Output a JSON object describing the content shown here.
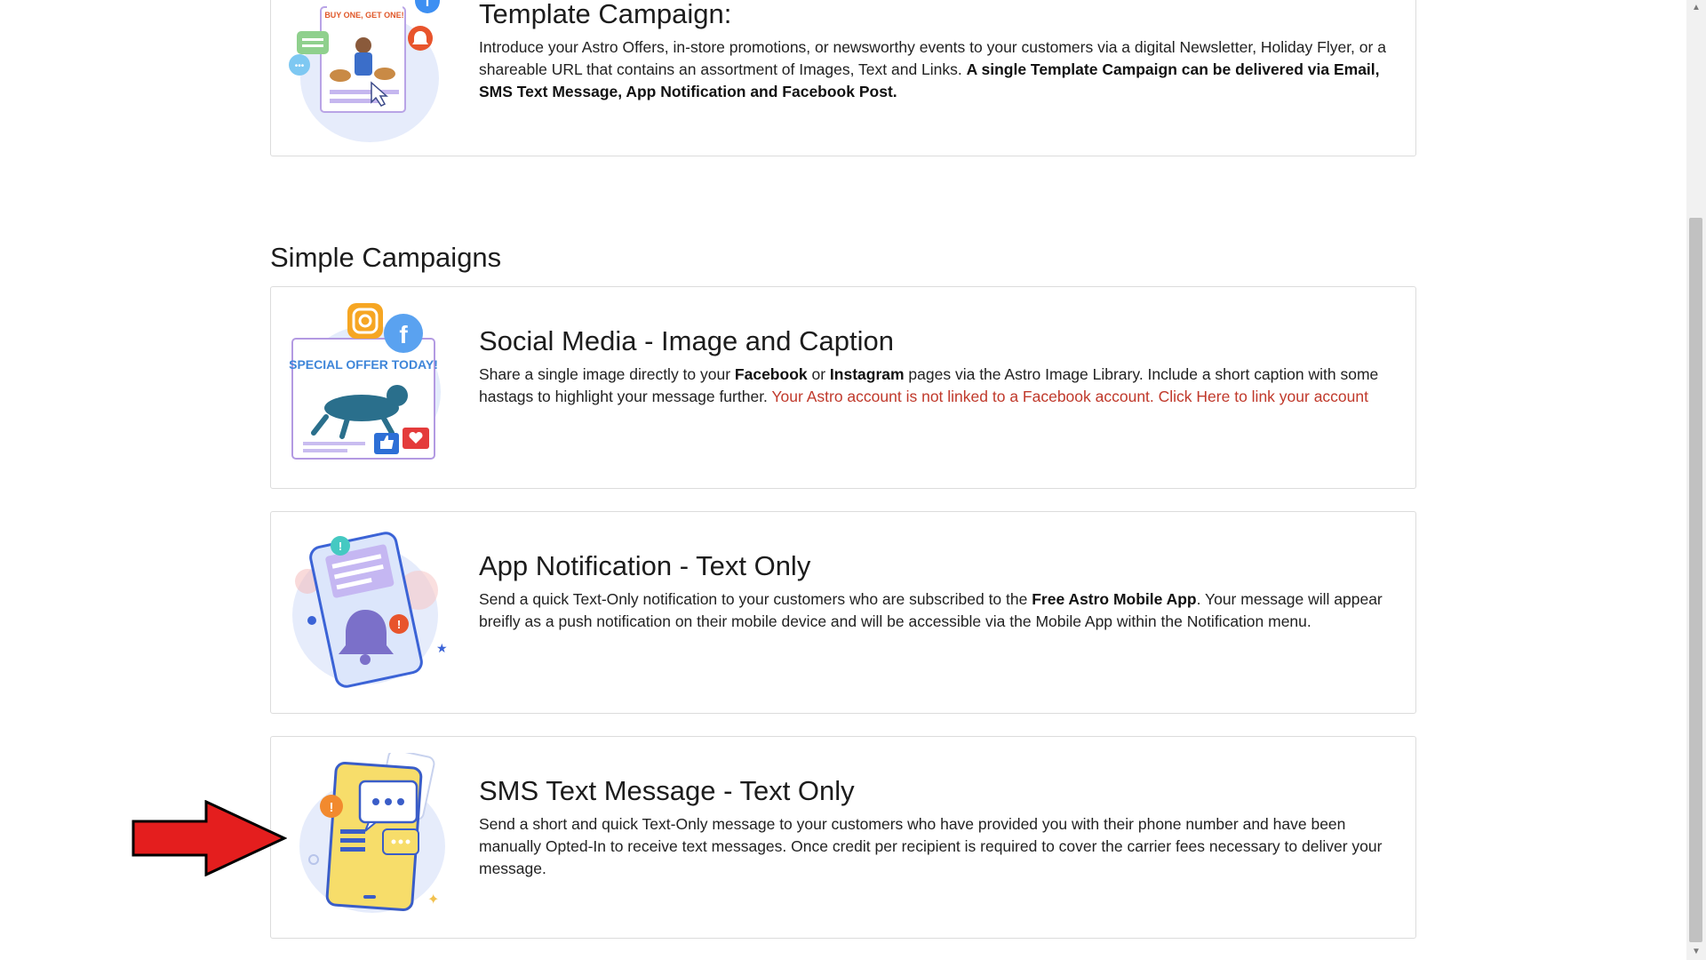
{
  "template_card": {
    "title": "Template Campaign:",
    "desc_part1": "Introduce your Astro Offers, in-store promotions, or newsworthy events to your customers via a digital Newsletter, Holiday Flyer, or a shareable URL that contains an assortment of Images, Text and Links. ",
    "desc_bold": "A single Template Campaign can be delivered via Email, SMS Text Message, App Notification and Facebook Post.",
    "illustration_text": "BUY ONE, GET ONE!"
  },
  "section": {
    "title": "Simple Campaigns"
  },
  "social_card": {
    "title": "Social Media - Image and Caption",
    "desc_part1": "Share a single image directly to your ",
    "desc_bold1": "Facebook",
    "desc_part2": " or ",
    "desc_bold2": "Instagram",
    "desc_part3": " pages via the Astro Image Library. Include a short caption with some hastags to highlight your message further. ",
    "warning_text": "Your Astro account is not linked to a Facebook account. Click Here to link your account",
    "illustration_text": "SPECIAL OFFER TODAY!"
  },
  "app_card": {
    "title": "App Notification - Text Only",
    "desc_part1": "Send a quick Text-Only notification to your customers who are subscribed to the ",
    "desc_bold": "Free Astro Mobile App",
    "desc_part2": ". Your message will appear breifly as a push notification on their mobile device and will be accessible via the Mobile App within the Notification menu."
  },
  "sms_card": {
    "title": "SMS Text Message - Text Only",
    "desc": "Send a short and quick Text-Only message to your customers who have provided you with their phone number and have been manually Opted-In to receive text messages. Once credit per recipient is required to cover the carrier fees necessary to deliver your message."
  },
  "colors": {
    "warning": "#c0392b",
    "arrow": "#e41e1e",
    "card_border": "#dcdcdc"
  },
  "icons": [
    "facebook-icon",
    "instagram-icon",
    "bell-icon",
    "chat-bubble-icon",
    "thumbs-up-icon",
    "heart-icon",
    "red-arrow-pointer"
  ]
}
